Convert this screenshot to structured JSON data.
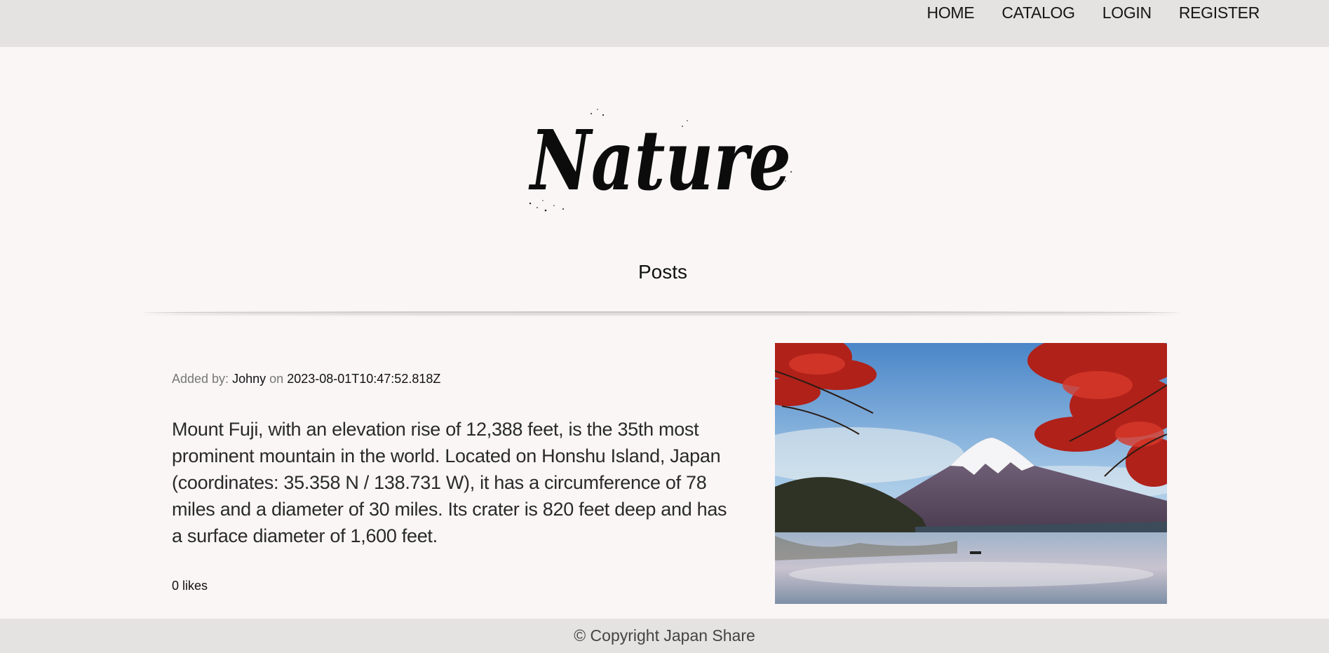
{
  "nav": {
    "home": "HOME",
    "catalog": "CATALOG",
    "login": "LOGIN",
    "register": "REGISTER"
  },
  "logo": {
    "text": "Nature"
  },
  "section": {
    "title": "Posts"
  },
  "post": {
    "added_by_label": "Added by:",
    "author": "Johny",
    "on_label": "on",
    "date": "2023-08-01T10:47:52.818Z",
    "description": "Mount Fuji, with an elevation rise of 12,388 feet, is the 35th most prominent mountain in the world. Located on Honshu Island, Japan (coordinates: 35.358 N / 138.731 W), it has a circumference of 78 miles and a diameter of 30 miles. Its crater is 820 feet deep and has a surface diameter of 1,600 feet.",
    "likes": "0 likes"
  },
  "footer": {
    "copyright": "© Copyright Japan Share"
  },
  "colors": {
    "background": "#faf6f6",
    "bars": "#e4e3e2",
    "text": "#111111"
  }
}
